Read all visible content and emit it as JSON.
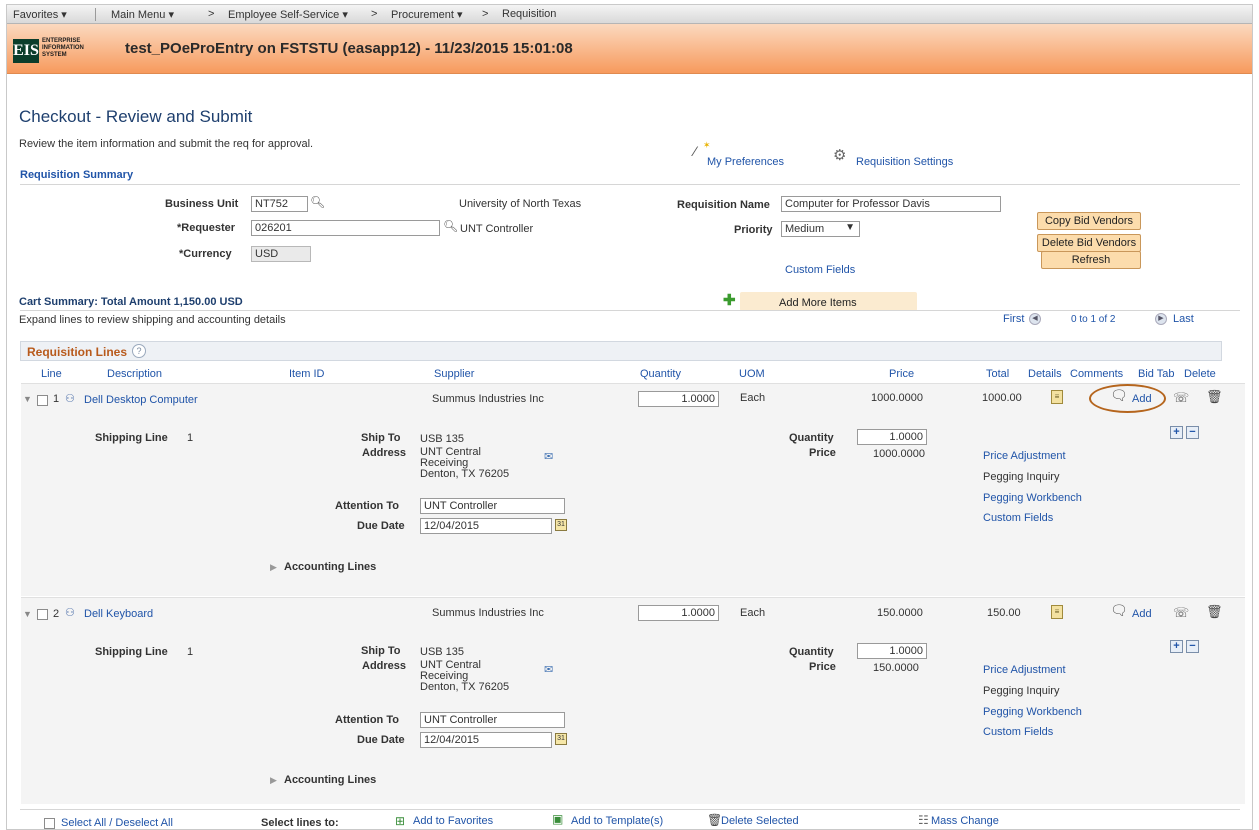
{
  "menubar": {
    "favorites": "Favorites ▾",
    "main_menu": "Main Menu ▾",
    "sep1": ">",
    "ess": "Employee Self-Service ▾",
    "sep2": ">",
    "procurement": "Procurement ▾",
    "sep3": ">",
    "requisition": "Requisition"
  },
  "banner": {
    "logo_text": "EIS",
    "logo_line1": "ENTERPRISE",
    "logo_line2": "INFORMATION",
    "logo_line3": "SYSTEM",
    "title": "test_POeProEntry on FSTSTU (easapp12) - 11/23/2015 15:01:08"
  },
  "page": {
    "title": "Checkout - Review and Submit",
    "instructions": "Review the item information and submit the req for approval.",
    "my_preferences": "My Preferences",
    "requisition_settings": "Requisition Settings",
    "section_title": "Requisition Summary"
  },
  "summary": {
    "business_unit_label": "Business Unit",
    "business_unit": "NT752",
    "business_unit_desc": "University of North Texas",
    "requester_label": "*Requester",
    "requester": "026201",
    "requester_desc": "UNT Controller",
    "currency_label": "*Currency",
    "currency": "USD",
    "req_name_label": "Requisition Name",
    "req_name": "Computer for Professor Davis",
    "priority_label": "Priority",
    "priority": "Medium",
    "custom_fields": "Custom Fields",
    "copy_bid_vendors": "Copy Bid Vendors",
    "delete_bid_vendors": "Delete Bid Vendors",
    "refresh": "Refresh"
  },
  "cart": {
    "total_label": "Cart Summary: Total Amount 1,150.00 USD",
    "add_more": "Add More Items",
    "expand_note": "Expand lines to review shipping and accounting details",
    "first": "First",
    "range": "0 to 1 of 2",
    "last": "Last"
  },
  "grid": {
    "title": "Requisition Lines",
    "help": "?",
    "headers": {
      "line": "Line",
      "description": "Description",
      "item_id": "Item ID",
      "supplier": "Supplier",
      "quantity": "Quantity",
      "uom": "UOM",
      "price": "Price",
      "total": "Total",
      "details": "Details",
      "comments": "Comments",
      "bid_tab": "Bid Tab",
      "delete": "Delete"
    }
  },
  "lines": [
    {
      "num": "1",
      "description": "Dell Desktop Computer",
      "supplier": "Summus Industries Inc",
      "quantity": "1.0000",
      "uom": "Each",
      "price": "1000.0000",
      "total": "1000.00",
      "comment_add": "Add",
      "shipping_label": "Shipping Line",
      "shipping_num": "1",
      "ship_to_label": "Ship To",
      "ship_to": "USB 135",
      "address_label": "Address",
      "address1": "UNT Central",
      "address2": "Receiving",
      "address3": "Denton, TX  76205",
      "attention_label": "Attention To",
      "attention": "UNT Controller",
      "due_label": "Due Date",
      "due": "12/04/2015",
      "sched_qty_label": "Quantity",
      "sched_qty": "1.0000",
      "sched_price_label": "Price",
      "sched_price": "1000.0000",
      "price_adjustment": "Price Adjustment",
      "pegging_inquiry": "Pegging Inquiry",
      "pegging_workbench": "Pegging Workbench",
      "custom_fields": "Custom Fields",
      "accounting_lines": "Accounting Lines"
    },
    {
      "num": "2",
      "description": "Dell Keyboard",
      "supplier": "Summus Industries Inc",
      "quantity": "1.0000",
      "uom": "Each",
      "price": "150.0000",
      "total": "150.00",
      "comment_add": "Add",
      "shipping_label": "Shipping Line",
      "shipping_num": "1",
      "ship_to_label": "Ship To",
      "ship_to": "USB 135",
      "address_label": "Address",
      "address1": "UNT Central",
      "address2": "Receiving",
      "address3": "Denton, TX  76205",
      "attention_label": "Attention To",
      "attention": "UNT Controller",
      "due_label": "Due Date",
      "due": "12/04/2015",
      "sched_qty_label": "Quantity",
      "sched_qty": "1.0000",
      "sched_price_label": "Price",
      "sched_price": "150.0000",
      "price_adjustment": "Price Adjustment",
      "pegging_inquiry": "Pegging Inquiry",
      "pegging_workbench": "Pegging Workbench",
      "custom_fields": "Custom Fields",
      "accounting_lines": "Accounting Lines"
    }
  ],
  "footer": {
    "select_all": "Select All / Deselect All",
    "select_lines_to": "Select lines to:",
    "add_favorites": "Add to Favorites",
    "add_template": "Add to Template(s)",
    "delete_selected": "Delete Selected",
    "mass_change": "Mass Change"
  },
  "colors": {
    "banner_orange": "#f79a5d",
    "link_blue": "#2054a8",
    "button_tan": "#fcdcac",
    "highlight_ring": "#b5651d"
  }
}
